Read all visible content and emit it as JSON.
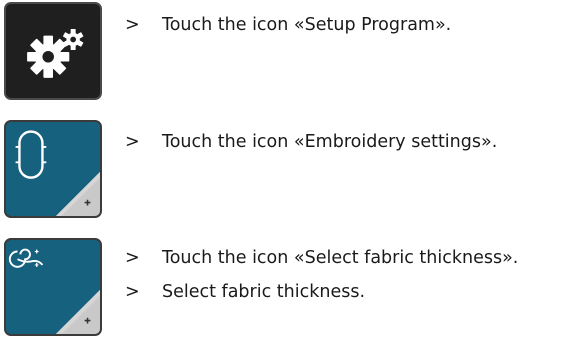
{
  "icons": {
    "setup": "gears-icon",
    "embroidery": "embroidery-hoop-icon",
    "fabric": "fabric-thickness-icon"
  },
  "colors": {
    "setup_bg": "#1f1f1f",
    "tile_bg": "#16617e",
    "tile_corner": "#c9c9c9"
  },
  "steps": [
    {
      "marker": ">",
      "text": "Touch the icon «Setup Program»."
    },
    {
      "marker": ">",
      "text": "Touch the icon «Embroidery settings»."
    },
    {
      "marker": ">",
      "text": "Touch the icon «Select fabric thickness»."
    },
    {
      "marker": ">",
      "text": "Select fabric thickness."
    }
  ]
}
